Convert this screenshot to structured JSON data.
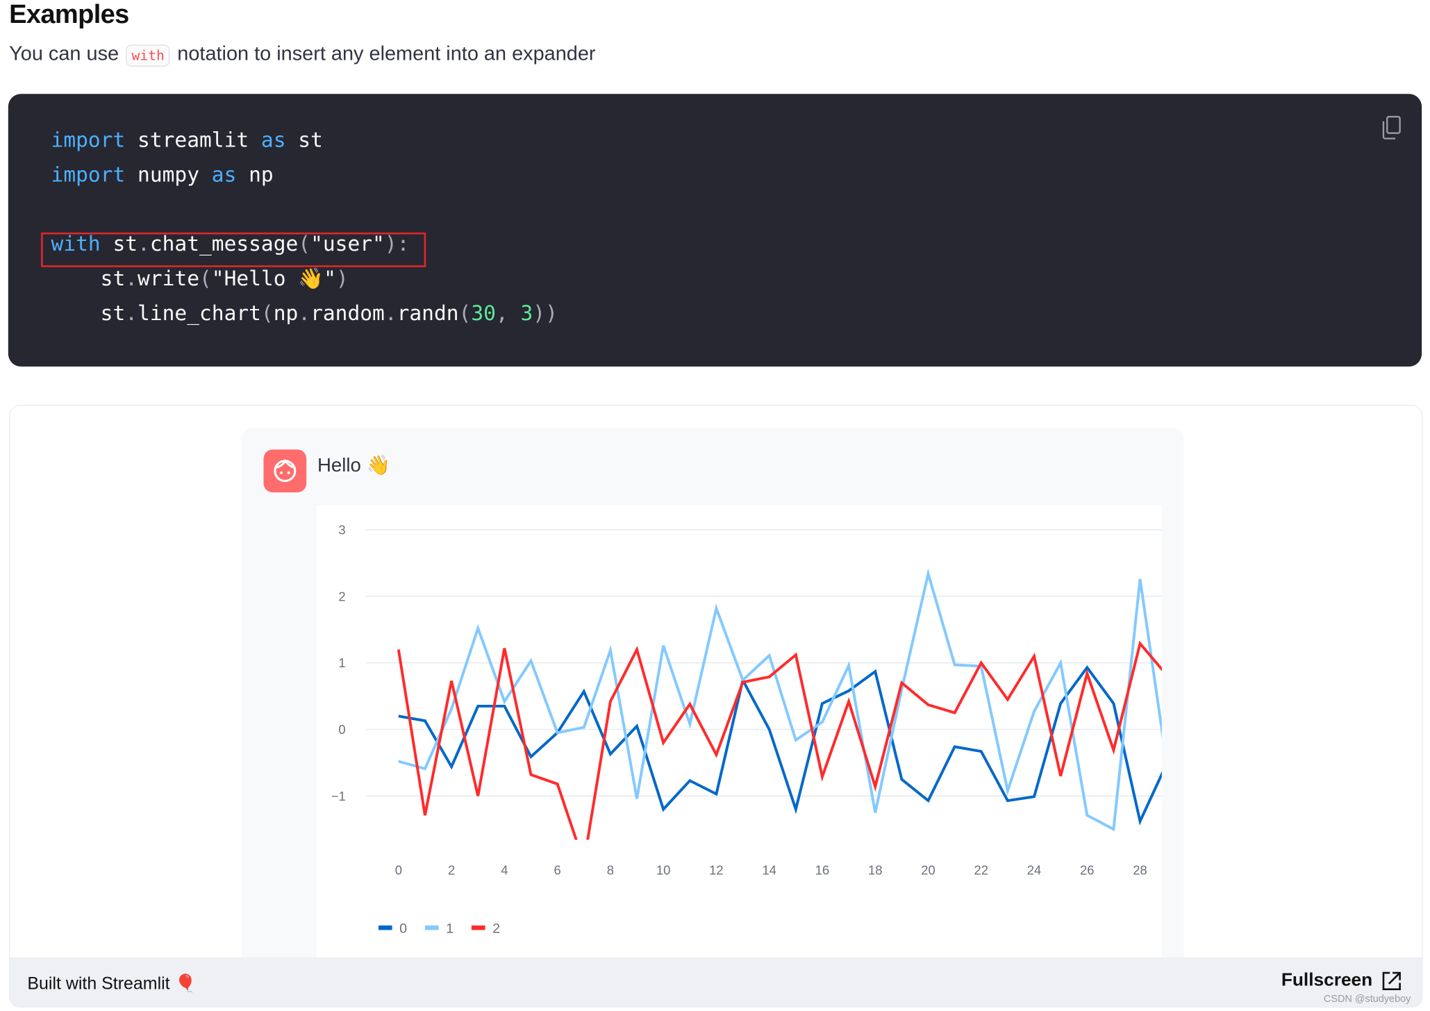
{
  "heading": "Examples",
  "intro": {
    "before": "You can use",
    "code": "with",
    "after": "notation to insert any element into an expander"
  },
  "code_lines": [
    [
      [
        "kw",
        "import"
      ],
      [
        "str",
        " streamlit "
      ],
      [
        "kw",
        "as"
      ],
      [
        "str",
        " st"
      ]
    ],
    [
      [
        "kw",
        "import"
      ],
      [
        "str",
        " numpy "
      ],
      [
        "kw",
        "as"
      ],
      [
        "str",
        " np"
      ]
    ],
    [],
    [
      [
        "kw",
        "with"
      ],
      [
        "str",
        " st"
      ],
      [
        "pn",
        "."
      ],
      [
        "str",
        "chat_message"
      ],
      [
        "pn",
        "("
      ],
      [
        "str",
        "\"user\""
      ],
      [
        "pn",
        ")"
      ],
      [
        "pn",
        ":"
      ]
    ],
    [
      [
        "str",
        "    st"
      ],
      [
        "pn",
        "."
      ],
      [
        "str",
        "write"
      ],
      [
        "pn",
        "("
      ],
      [
        "str",
        "\"Hello 👋\""
      ],
      [
        "pn",
        ")"
      ]
    ],
    [
      [
        "str",
        "    st"
      ],
      [
        "pn",
        "."
      ],
      [
        "str",
        "line_chart"
      ],
      [
        "pn",
        "("
      ],
      [
        "str",
        "np"
      ],
      [
        "pn",
        "."
      ],
      [
        "str",
        "random"
      ],
      [
        "pn",
        "."
      ],
      [
        "str",
        "randn"
      ],
      [
        "pn",
        "("
      ],
      [
        "num",
        "30"
      ],
      [
        "pn",
        ", "
      ],
      [
        "num",
        "3"
      ],
      [
        "pn",
        "))"
      ]
    ]
  ],
  "copy_icon": "copy-icon",
  "chat": {
    "avatar_icon": "user-face-icon",
    "avatar_color": "#ff6c6c",
    "message": "Hello 👋"
  },
  "chart_data": {
    "type": "line",
    "x": [
      0,
      1,
      2,
      3,
      4,
      5,
      6,
      7,
      8,
      9,
      10,
      11,
      12,
      13,
      14,
      15,
      16,
      17,
      18,
      19,
      20,
      21,
      22,
      23,
      24,
      25,
      26,
      27,
      28,
      29
    ],
    "xticks": [
      0,
      2,
      4,
      6,
      8,
      10,
      12,
      14,
      16,
      18,
      20,
      22,
      24,
      26,
      28
    ],
    "yticks": [
      3,
      2,
      1,
      0,
      -1
    ],
    "ylim": [
      -1.65,
      3
    ],
    "xlim": [
      0,
      29
    ],
    "grid": true,
    "legend": "bottom-left",
    "series": [
      {
        "name": "0",
        "color": "#0068c9",
        "values": [
          0.2,
          0.13,
          -0.56,
          0.35,
          0.35,
          -0.41,
          -0.05,
          0.57,
          -0.37,
          0.05,
          -1.2,
          -0.77,
          -0.97,
          0.74,
          0.0,
          -1.2,
          0.39,
          0.58,
          0.87,
          -0.75,
          -1.07,
          -0.26,
          -0.33,
          -1.07,
          -1.01,
          0.39,
          0.93,
          0.39,
          -1.38,
          -0.52
        ]
      },
      {
        "name": "1",
        "color": "#83c9ff",
        "values": [
          -0.48,
          -0.59,
          0.31,
          1.52,
          0.42,
          1.03,
          -0.05,
          0.03,
          1.19,
          -1.04,
          1.26,
          0.08,
          1.82,
          0.74,
          1.11,
          -0.16,
          0.11,
          0.96,
          -1.25,
          0.6,
          2.34,
          0.97,
          0.95,
          -0.92,
          0.27,
          1.0,
          -1.29,
          -1.5,
          2.26,
          -0.49
        ]
      },
      {
        "name": "2",
        "color": "#ff2b2b",
        "values": [
          1.2,
          -1.29,
          0.73,
          -1.0,
          1.22,
          -0.68,
          -0.82,
          -2.0,
          0.42,
          1.2,
          -0.2,
          0.38,
          -0.38,
          0.71,
          0.79,
          1.12,
          -0.71,
          0.42,
          -0.86,
          0.7,
          0.37,
          0.25,
          1.0,
          0.45,
          1.1,
          -0.7,
          0.84,
          -0.31,
          1.29,
          0.82
        ]
      }
    ]
  },
  "footer": {
    "built": "Built with Streamlit 🎈",
    "fullscreen": "Fullscreen",
    "watermark": "CSDN @studyeboy"
  }
}
